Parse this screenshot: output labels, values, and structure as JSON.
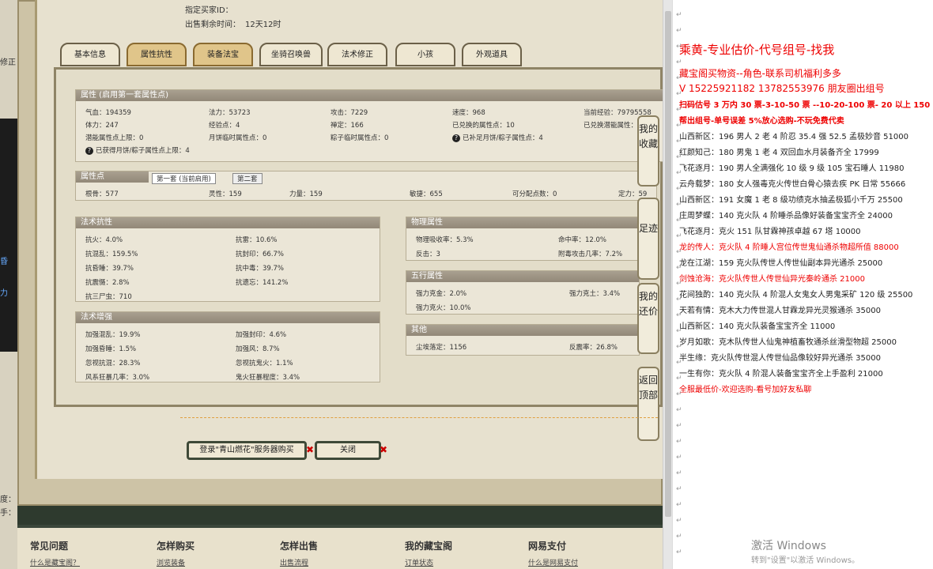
{
  "header": {
    "seller_label": "指定买家ID：",
    "time_label": "出售剩余时间：",
    "time_value": "12天12时"
  },
  "tabs": [
    "基本信息",
    "属性抗性",
    "装备法宝",
    "坐骑召唤兽",
    "法术修正",
    "小孩",
    "外观道具"
  ],
  "active_tab": "装备法宝",
  "attr": {
    "title": "属性 (启用第一套属性点)",
    "rows": [
      [
        "气血：194359",
        "法力：53723",
        "攻击：7229",
        "速度：968",
        "当前经验：79795558"
      ],
      [
        "体力：247",
        "经验点：4",
        "禅定：166",
        "已兑换的属性点：10",
        "已兑换潜能属性："
      ],
      [
        "潜能属性点上限：0",
        "月饼临时属性点：0",
        "粽子临时属性点：0",
        "已补足月饼/粽子属性点：4"
      ]
    ],
    "note": "已获得月饼/粽子属性点上限：4"
  },
  "points": {
    "title": "属性点",
    "tab1": "第一套 (当前启用)",
    "tab2": "第二套",
    "row": [
      "根骨：577",
      "灵性：159",
      "力量：159",
      "敏捷：655",
      "可分配点数：0",
      "定力：59"
    ]
  },
  "magic": {
    "title": "法术抗性",
    "rows": [
      [
        "抗火：4.0%",
        "抗雷：10.6%"
      ],
      [
        "抗混乱：159.5%",
        "抗封印：66.7%"
      ],
      [
        "抗昏睡：39.7%",
        "抗中毒：39.7%"
      ],
      [
        "抗震慑：2.8%",
        "抗遗忘：141.2%"
      ],
      [
        "抗三尸虫：710",
        ""
      ]
    ]
  },
  "boost": {
    "title": "法术增强",
    "rows": [
      [
        "加强混乱：19.9%",
        "加强封印：4.6%"
      ],
      [
        "加强昏睡：1.5%",
        "加强风：8.7%"
      ],
      [
        "忽视抗混：28.3%",
        "忽视抗鬼火：1.1%"
      ],
      [
        "风系狂暴几率：3.0%",
        "鬼火狂暴程度：3.4%"
      ]
    ]
  },
  "phys": {
    "title": "物理属性",
    "rows": [
      [
        "物理吸收率：5.3%",
        "命中率：12.0%"
      ],
      [
        "反击：3",
        "附毒攻击几率：7.2%"
      ]
    ]
  },
  "five": {
    "title": "五行属性",
    "rows": [
      [
        "强力克金：2.0%",
        "强力克土：3.4%"
      ],
      [
        "强力克火：10.0%",
        ""
      ]
    ]
  },
  "other": {
    "title": "其他",
    "rows": [
      [
        "尘埃落定：1156",
        "反震率：26.8%"
      ]
    ]
  },
  "buttons": {
    "buy": "登录\"青山燃花\"服务器购买",
    "close": "关闭"
  },
  "side": [
    "我的收藏",
    "足迹",
    "我的还价",
    "返回顶部"
  ],
  "footer": [
    {
      "title": "常见问题",
      "link": "什么是藏宝阁？"
    },
    {
      "title": "怎样购买",
      "link": "浏览装备"
    },
    {
      "title": "怎样出售",
      "link": "出售流程"
    },
    {
      "title": "我的藏宝阁",
      "link": "订单状态"
    },
    {
      "title": "网易支付",
      "link": "什么是网易支付"
    }
  ],
  "left_strip": [
    "修正",
    "昏",
    "力",
    "度：",
    "手："
  ],
  "right_lines": [
    {
      "t": "乘黄-专业估价-代号组号-找我",
      "c": "red",
      "s": "big"
    },
    {
      "t": "藏宝阁买物资--角色-联系司机福利多多",
      "c": "red"
    },
    {
      "t": "V 15225921182   13782553976 朋友圈出组号",
      "c": "red",
      "s": "mid"
    },
    {
      "t": "扫码估号 3 万内 30 票-3-10-50 票   --10-20-100 票- 20 以上 150",
      "c": "red",
      "b": true
    },
    {
      "t": "帮出组号-单号误差 5%放心选购-不玩免费代卖",
      "c": "red",
      "b": true
    },
    {
      "t": "山西新区：196 男人 2 老 4 阶忍 35.4 强 52.5 孟极妙音 51000"
    },
    {
      "t": "红颜知己：180 男鬼 1 老 4 双回血水月装备齐全 17999"
    },
    {
      "t": "飞花逐月：190 男人全满强化 10 级 9 级 105 宝石睡人 11980"
    },
    {
      "t": "云舟载梦：180 女人强毒克火传世白骨心猿去疾 PK 日常 55666"
    },
    {
      "t": "山西新区：191 女魔 1 老 8 级功绩克水抽孟极狐小千万 25500"
    },
    {
      "t": "庄周梦蝶：140 克火队 4 阶睡杀品像好装备宝宝齐全 24000"
    },
    {
      "t": "飞花逐月：克火 151 队甘霖神孩卓越 67 塔 10000"
    },
    {
      "t": "龙的传人：克火队 4 阶睡人宫位传世鬼仙通杀物超所值 88000",
      "c": "red"
    },
    {
      "t": "龙在江湖：159 克火队传世人传世仙副本异光通杀 25000"
    },
    {
      "t": "剑蚀沧海：克火队传世人传世仙异光秦岭通杀 21000",
      "c": "red"
    },
    {
      "t": "花间独酌：140 克火队 4 阶混人女鬼女人男鬼采矿 120 级 25500"
    },
    {
      "t": "天若有情：克木大力传世混人甘霖龙异光灵猴通杀 35000"
    },
    {
      "t": "山西新区：140 克火队装备宝宝齐全 11000"
    },
    {
      "t": "岁月如歌：克木队传世人仙鬼神植畜牧通杀丝滑型物超 25000"
    },
    {
      "t": "半生缘：克火队传世混人传世仙品像较好异光通杀 35000"
    },
    {
      "t": "一生有你：克火队 4 阶混人装备宝宝齐全上手盈利 21000"
    },
    {
      "t": "全服最低价-欢迎选购-看号加好友私聊",
      "c": "red"
    }
  ],
  "watermark": {
    "line1": "激活 Windows",
    "line2": "转到\"设置\"以激活 Windows。"
  }
}
